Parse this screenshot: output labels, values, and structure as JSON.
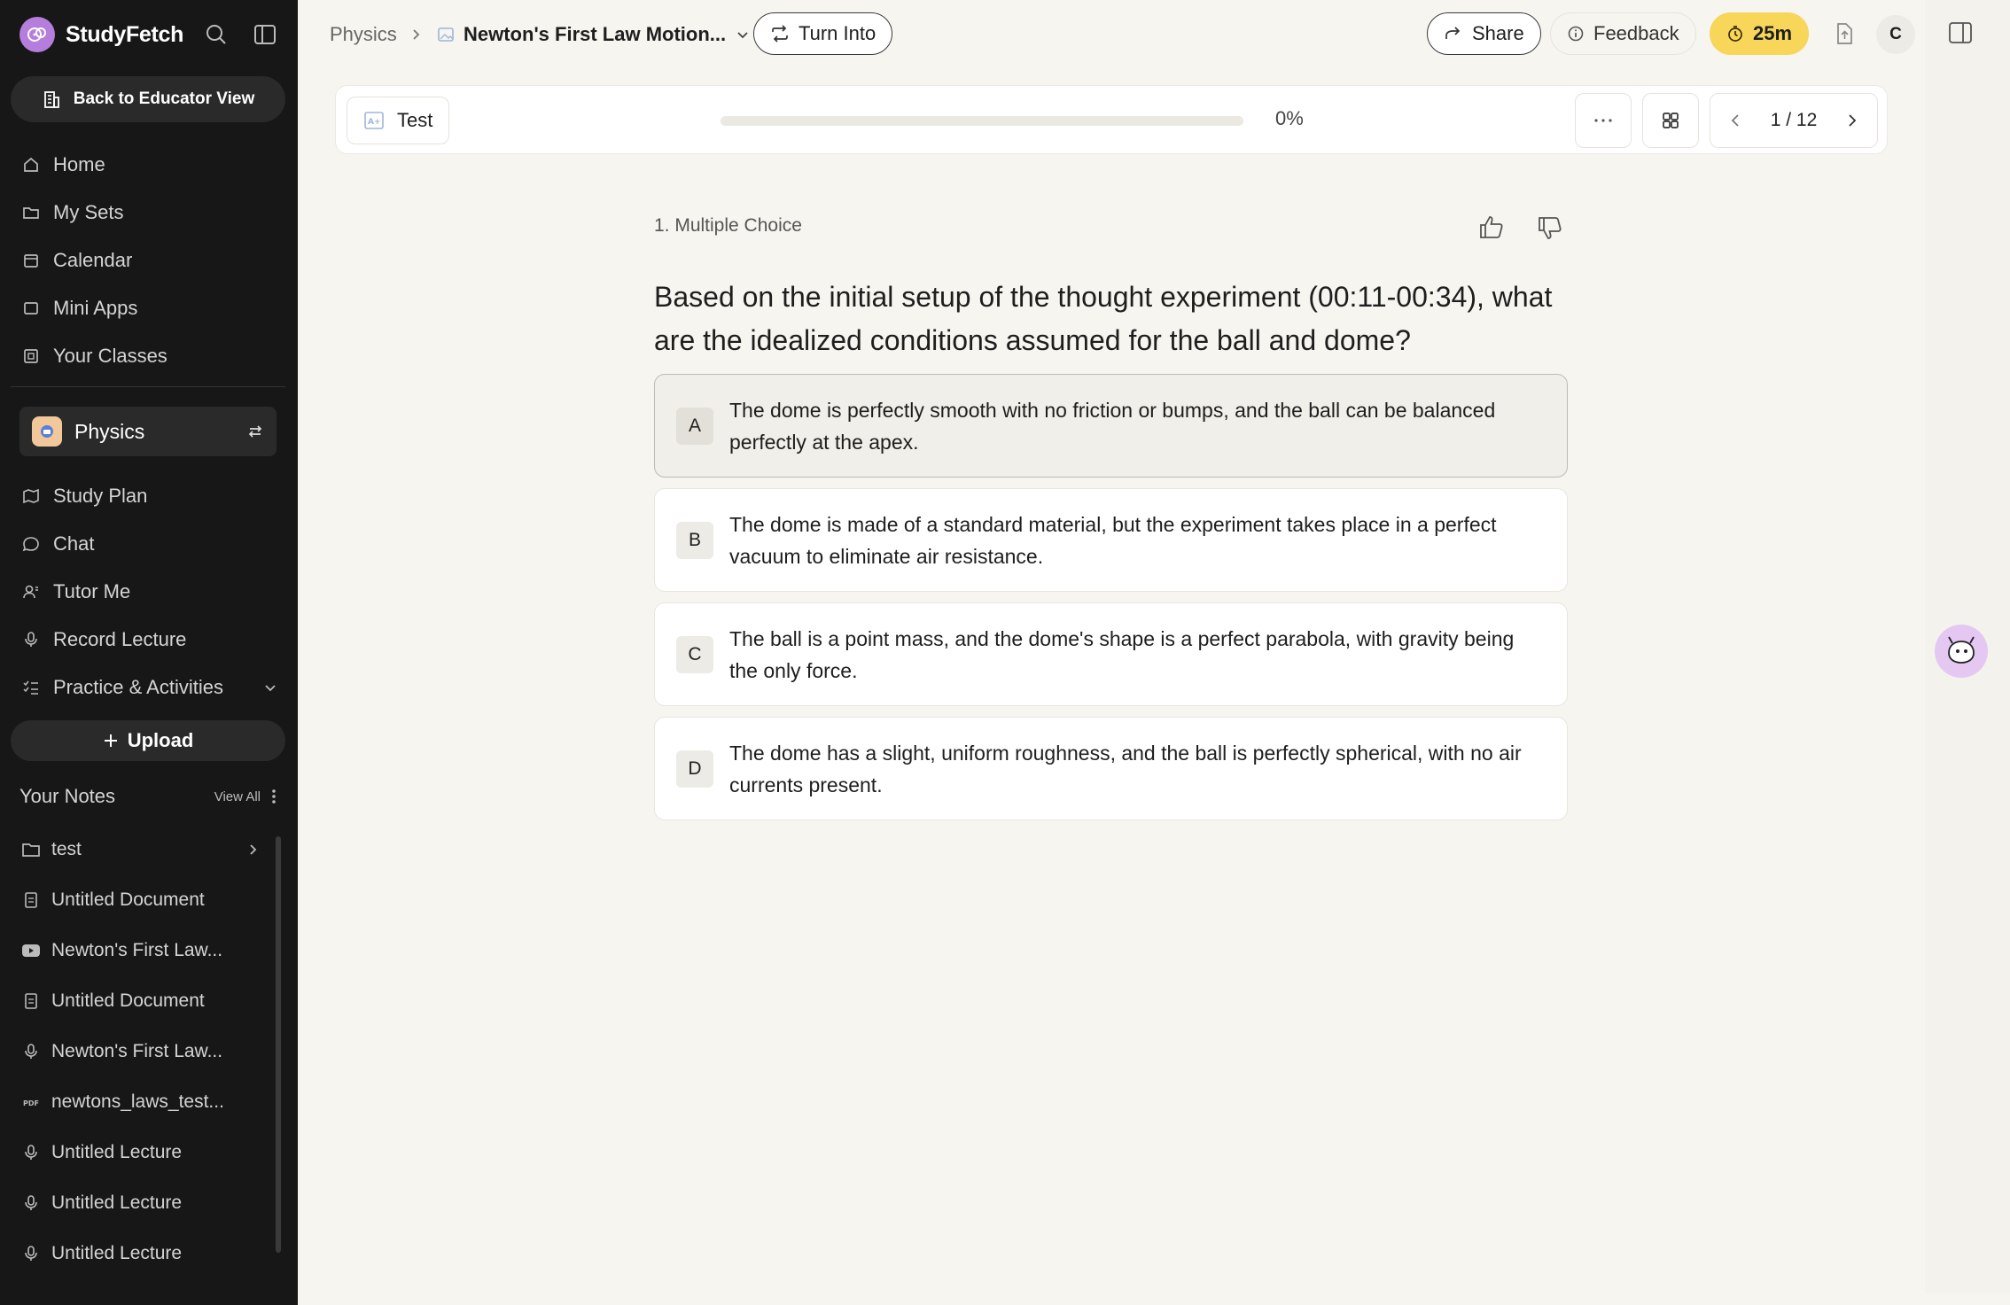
{
  "app": {
    "name": "StudyFetch"
  },
  "sidebar": {
    "educator_button": "Back to Educator View",
    "nav": [
      {
        "label": "Home",
        "icon": "home-icon"
      },
      {
        "label": "My Sets",
        "icon": "folders-icon"
      },
      {
        "label": "Calendar",
        "icon": "calendar-icon"
      },
      {
        "label": "Mini Apps",
        "icon": "app-window-icon"
      },
      {
        "label": "Your Classes",
        "icon": "classes-icon"
      }
    ],
    "class": {
      "name": "Physics"
    },
    "class_nav": [
      {
        "label": "Study Plan",
        "icon": "map-icon"
      },
      {
        "label": "Chat",
        "icon": "chat-bubble-icon"
      },
      {
        "label": "Tutor Me",
        "icon": "tutor-icon"
      },
      {
        "label": "Record Lecture",
        "icon": "microphone-icon"
      },
      {
        "label": "Practice & Activities",
        "icon": "list-checks-icon"
      }
    ],
    "upload_label": "Upload",
    "notes": {
      "title": "Your Notes",
      "view_all": "View All",
      "items": [
        {
          "label": "test",
          "icon": "folder-icon"
        },
        {
          "label": "Untitled Document",
          "icon": "document-icon"
        },
        {
          "label": "Newton's First Law...",
          "icon": "youtube-icon"
        },
        {
          "label": "Untitled Document",
          "icon": "document-icon"
        },
        {
          "label": "Newton's First Law...",
          "icon": "microphone-icon"
        },
        {
          "label": "newtons_laws_test...",
          "icon": "pdf-icon"
        },
        {
          "label": "Untitled Lecture",
          "icon": "microphone-icon"
        },
        {
          "label": "Untitled Lecture",
          "icon": "microphone-icon"
        },
        {
          "label": "Untitled Lecture",
          "icon": "microphone-icon"
        }
      ]
    }
  },
  "topbar": {
    "breadcrumb_root": "Physics",
    "breadcrumb_current": "Newton's First Law Motion...",
    "turn_into": "Turn Into",
    "share": "Share",
    "feedback": "Feedback",
    "timer": "25m",
    "avatar_initial": "C"
  },
  "test": {
    "label": "Test",
    "progress_percent": 0,
    "progress_label": "0%",
    "pager": "1 / 12"
  },
  "question": {
    "type_label": "1. Multiple Choice",
    "text": "Based on the initial setup of the thought experiment (00:11-00:34), what are the idealized conditions assumed for the ball and dome?",
    "options": [
      {
        "letter": "A",
        "text": "The dome is perfectly smooth with no friction or bumps, and the ball can be balanced perfectly at the apex.",
        "selected": true
      },
      {
        "letter": "B",
        "text": "The dome is made of a standard material, but the experiment takes place in a perfect vacuum to eliminate air resistance.",
        "selected": false
      },
      {
        "letter": "C",
        "text": "The ball is a point mass, and the dome's shape is a perfect parabola, with gravity being the only force.",
        "selected": false
      },
      {
        "letter": "D",
        "text": "The dome has a slight, uniform roughness, and the ball is perfectly spherical, with no air currents present.",
        "selected": false
      }
    ]
  },
  "colors": {
    "accent": "#b57edc",
    "timer": "#f7d65a",
    "sidebar": "#171717"
  }
}
